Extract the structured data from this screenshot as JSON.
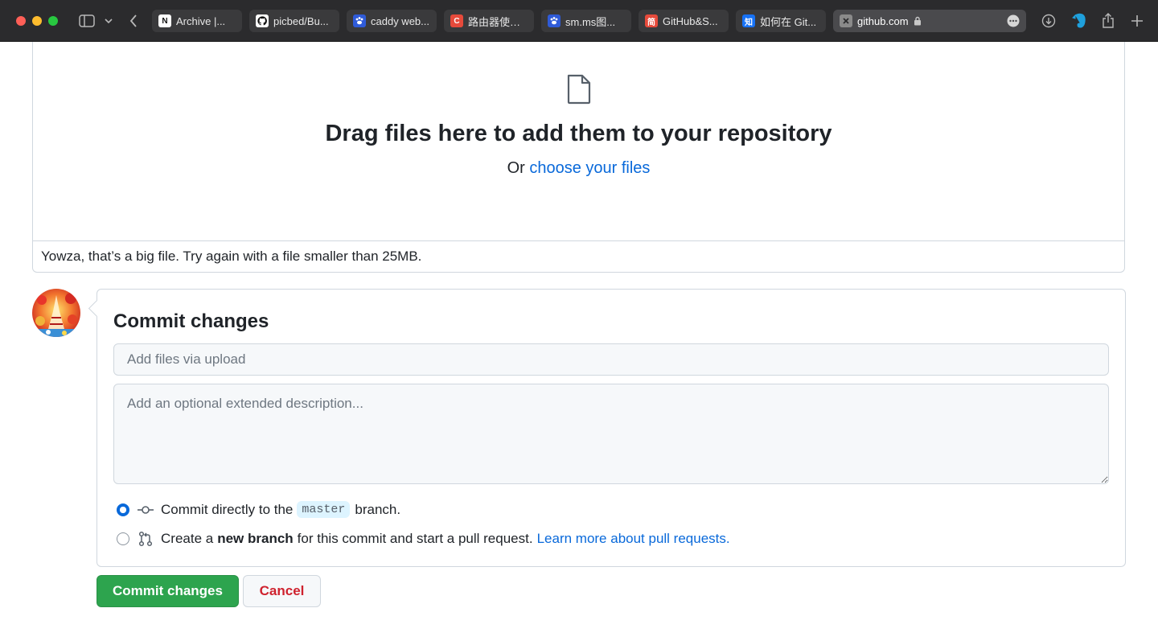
{
  "browser": {
    "tabs": [
      {
        "label": "Archive |...",
        "favicon": "N",
        "favicon_color": "#ffffff",
        "favicon_text": "#111111"
      },
      {
        "label": "picbed/Bu...",
        "favicon": "github",
        "favicon_color": "#ffffff",
        "favicon_text": "#111111"
      },
      {
        "label": "caddy web...",
        "favicon": "paw",
        "favicon_color": "#2f5bd8",
        "favicon_text": "#ffffff"
      },
      {
        "label": "路由器使用...",
        "favicon": "C",
        "favicon_color": "#e64a3b",
        "favicon_text": "#ffffff"
      },
      {
        "label": "sm.ms图...",
        "favicon": "paw",
        "favicon_color": "#2f5bd8",
        "favicon_text": "#ffffff"
      },
      {
        "label": "GitHub&S...",
        "favicon": "简",
        "favicon_color": "#e64a3b",
        "favicon_text": "#ffffff"
      },
      {
        "label": "如何在 Git...",
        "favicon": "知",
        "favicon_color": "#1772f6",
        "favicon_text": "#ffffff"
      }
    ],
    "active_tab": {
      "label": "github.com",
      "icon": "lock-icon"
    }
  },
  "upload": {
    "title": "Drag files here to add them to your repository",
    "or_text": "Or",
    "choose_link": "choose your files",
    "error": "Yowza, that’s a big file. Try again with a file smaller than 25MB."
  },
  "commit": {
    "title": "Commit changes",
    "summary_placeholder": "Add files via upload",
    "description_placeholder": "Add an optional extended description...",
    "option_direct": {
      "prefix": "Commit directly to the",
      "branch": "master",
      "suffix": "branch."
    },
    "option_new": {
      "prefix": "Create a",
      "bold": "new branch",
      "middle": "for this commit and start a pull request.",
      "link": "Learn more about pull requests."
    },
    "submit_label": "Commit changes",
    "cancel_label": "Cancel"
  },
  "colors": {
    "accent": "#0969da",
    "primary_button": "#2da44e",
    "danger": "#cf222e"
  }
}
